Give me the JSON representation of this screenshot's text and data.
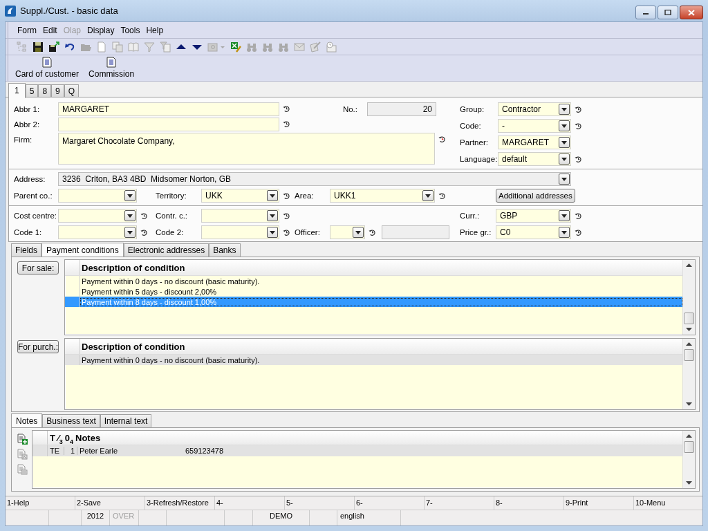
{
  "window": {
    "title": "Suppl./Cust. - basic data"
  },
  "menu": [
    {
      "label": "Form",
      "disabled": false
    },
    {
      "label": "Edit",
      "disabled": false
    },
    {
      "label": "Olap",
      "disabled": true
    },
    {
      "label": "Display",
      "disabled": false
    },
    {
      "label": "Tools",
      "disabled": false
    },
    {
      "label": "Help",
      "disabled": false
    }
  ],
  "toolbar": [
    {
      "kind": "tree",
      "disabled": true
    },
    {
      "kind": "floppy-disk",
      "disabled": false
    },
    {
      "kind": "floppy-disk-arrow",
      "disabled": false
    },
    {
      "kind": "undo",
      "disabled": false
    },
    {
      "kind": "folder",
      "disabled": true
    },
    {
      "kind": "page",
      "disabled": true
    },
    {
      "kind": "pages",
      "disabled": true
    },
    {
      "kind": "book",
      "disabled": true
    },
    {
      "kind": "funnel",
      "disabled": true
    },
    {
      "kind": "funnel-page",
      "disabled": true
    },
    {
      "kind": "up-arrow",
      "disabled": false
    },
    {
      "kind": "down-arrow",
      "disabled": false
    },
    {
      "kind": "picture-menu",
      "disabled": true
    },
    {
      "kind": "spreadsheet-pen",
      "disabled": false
    },
    {
      "kind": "binoculars",
      "disabled": true
    },
    {
      "kind": "binoculars",
      "disabled": true
    },
    {
      "kind": "binoculars",
      "disabled": true
    },
    {
      "kind": "envelope",
      "disabled": true
    },
    {
      "kind": "notepad-pen",
      "disabled": true
    },
    {
      "kind": "card-clock",
      "disabled": true
    }
  ],
  "actions": [
    "Card of customer",
    "Commission"
  ],
  "record_tabs": [
    {
      "label": "1",
      "selected": true
    },
    {
      "label": "5",
      "selected": false
    },
    {
      "label": "8",
      "selected": false
    },
    {
      "label": "9",
      "selected": false
    },
    {
      "label": "Q",
      "selected": false
    }
  ],
  "form": {
    "abbr_1": {
      "label": "Abbr 1:",
      "value": "MARGARET",
      "readonly": false,
      "history": true
    },
    "abbr_2": {
      "label": "Abbr 2:",
      "readonly": false,
      "history": true
    },
    "number": {
      "label": "No.:",
      "value": "20",
      "readonly": true
    },
    "firm": {
      "label": "Firm:",
      "value": "Margaret Chocolate Company,",
      "readonly": false,
      "history": true,
      "history_modified": true
    },
    "group": {
      "label": "Group:",
      "value": "Contractor",
      "readonly": false,
      "history": true
    },
    "code": {
      "label": "Code:",
      "value": "-",
      "readonly": false,
      "history": true
    },
    "partner": {
      "label": "Partner:",
      "value": "MARGARET",
      "readonly": false,
      "history": false
    },
    "language": {
      "label": "Language:",
      "value": "default",
      "readonly": false,
      "history": true
    },
    "address": {
      "label": "Address:",
      "value": "3236  Crlton, BA3 4BD  Midsomer Norton, GB",
      "readonly": true
    },
    "parent_co": {
      "label": "Parent co.:",
      "readonly": false
    },
    "territory": {
      "label": "Territory:",
      "value": "UKK",
      "readonly": false,
      "history": true
    },
    "area": {
      "label": "Area:",
      "value": "UKK1",
      "readonly": false,
      "history": true
    },
    "additional_addresses": {
      "label": "Additional addresses"
    },
    "cost_centre": {
      "label": "Cost centre:",
      "readonly": false,
      "history": true
    },
    "contr_c": {
      "label": "Contr. c.:",
      "readonly": false,
      "history": true
    },
    "currency": {
      "label": "Curr.:",
      "value": "GBP",
      "readonly": false,
      "history": true
    },
    "code_1": {
      "label": "Code 1:",
      "readonly": false,
      "history": true
    },
    "code_2": {
      "label": "Code 2:",
      "readonly": false,
      "history": true
    },
    "officer": {
      "label": "Officer:",
      "readonly": false,
      "history": true
    },
    "officer_name": {
      "readonly": true
    },
    "price_group": {
      "label": "Price gr.:",
      "value": "C0",
      "readonly": false,
      "history": true
    }
  },
  "detail_tabs": [
    {
      "label": "Fields",
      "selected": false
    },
    {
      "label": "Payment conditions",
      "selected": true
    },
    {
      "label": "Electronic addresses",
      "selected": false
    },
    {
      "label": "Banks",
      "selected": false
    }
  ],
  "payment_conditions": [
    {
      "button": "For sale:",
      "header": "Description of condition",
      "focused": true,
      "rows": [
        {
          "text": "Payment within 0 days - no discount (basic maturity).",
          "selected": false
        },
        {
          "text": "Payment within 5 days - discount 2,00%",
          "selected": false
        },
        {
          "text": "Payment within 8 days - discount 1,00%",
          "selected": true
        }
      ]
    },
    {
      "button": "For purch.:",
      "header": "Description of condition",
      "focused": false,
      "rows": [
        {
          "text": "Payment within 0 days - no discount (basic maturity).",
          "selected": true
        }
      ]
    }
  ],
  "notes_tabs": [
    {
      "label": "Notes",
      "selected": true
    },
    {
      "label": "Business text",
      "selected": false
    },
    {
      "label": "Internal text",
      "selected": false
    }
  ],
  "note_actions": [
    {
      "kind": "document-plus",
      "disabled": false
    },
    {
      "kind": "document-picture",
      "disabled": true
    },
    {
      "kind": "document-list",
      "disabled": true
    }
  ],
  "notes": {
    "columns": [
      "T ⁄$_{3}$",
      "0$_{4}$",
      "Notes"
    ],
    "focused": false,
    "rows": [
      {
        "cells": [
          "TE",
          "1",
          "Peter Earle",
          "659123478"
        ],
        "selected": true
      }
    ]
  },
  "function_keys": [
    "1-Help",
    "2-Save",
    "3-Refresh/Restore",
    "4-",
    "5-",
    "6-",
    "7-",
    "8-",
    "9-Print",
    "10-Menu"
  ],
  "status_bar": [
    {
      "text": "2012",
      "disabled": false
    },
    {
      "text": "OVER",
      "disabled": true
    },
    {
      "text": "DEMO",
      "disabled": false
    },
    {
      "text": "english",
      "disabled": false
    }
  ]
}
